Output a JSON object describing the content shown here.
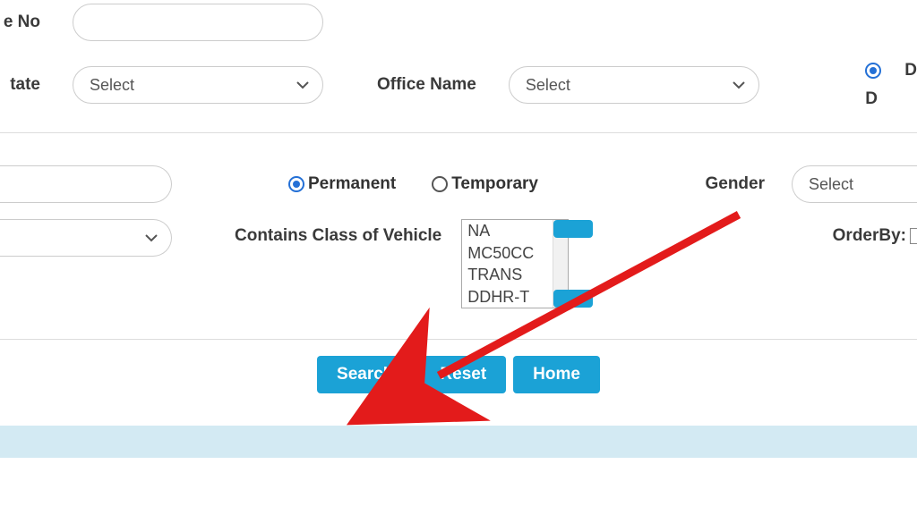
{
  "row1": {
    "label_left": "e No"
  },
  "row2": {
    "label_left": "tate",
    "state_selected": "Select",
    "label_office": "Office Name",
    "office_selected": "Select",
    "right_radio_top": "D",
    "right_radio_bottom": "D"
  },
  "section2": {
    "radio_permanent": "Permanent",
    "radio_temporary": "Temporary",
    "label_gender": "Gender",
    "gender_selected": "Select",
    "label_class": "Contains Class of Vehicle",
    "class_options": [
      "NA",
      "MC50CC",
      "TRANS",
      "DDHR-T"
    ],
    "label_orderby": "OrderBy:"
  },
  "buttons": {
    "search": "Search",
    "reset": "Reset",
    "home": "Home"
  }
}
